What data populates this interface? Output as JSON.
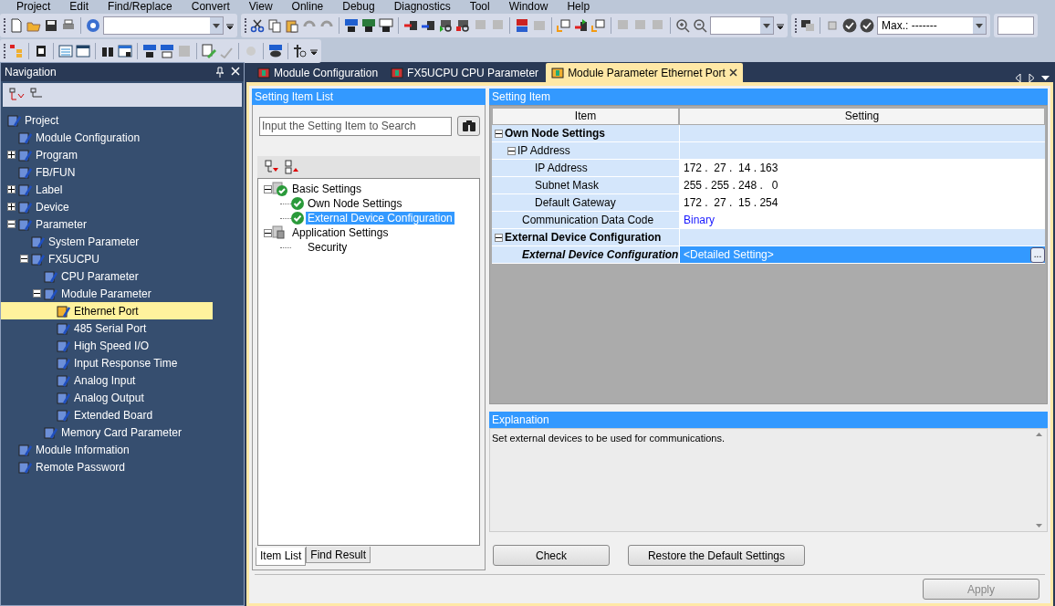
{
  "menu": [
    "Project",
    "Edit",
    "Find/Replace",
    "Convert",
    "View",
    "Online",
    "Debug",
    "Diagnostics",
    "Tool",
    "Window",
    "Help"
  ],
  "toolbar": {
    "monitor_combo": "Max.: -------"
  },
  "navigation": {
    "title": "Navigation",
    "tree": [
      {
        "label": "Project",
        "children": [
          {
            "label": "Module Configuration",
            "selected": false
          },
          {
            "label": "Program",
            "expanded": false,
            "selected": false
          },
          {
            "label": "FB/FUN",
            "selected": false
          },
          {
            "label": "Label",
            "expanded": false,
            "selected": false
          },
          {
            "label": "Device",
            "expanded": false,
            "selected": false
          },
          {
            "label": "Parameter",
            "expanded": true,
            "selected": false,
            "children": [
              {
                "label": "System Parameter",
                "selected": false
              },
              {
                "label": "FX5UCPU",
                "expanded": true,
                "selected": false,
                "children": [
                  {
                    "label": "CPU Parameter",
                    "selected": false
                  },
                  {
                    "label": "Module Parameter",
                    "expanded": true,
                    "selected": false,
                    "children": [
                      {
                        "label": "Ethernet Port",
                        "selected": true
                      },
                      {
                        "label": "485 Serial Port",
                        "selected": false
                      },
                      {
                        "label": "High Speed I/O",
                        "selected": false
                      },
                      {
                        "label": "Input Response Time",
                        "selected": false
                      },
                      {
                        "label": "Analog Input",
                        "selected": false
                      },
                      {
                        "label": "Analog Output",
                        "selected": false
                      },
                      {
                        "label": "Extended Board",
                        "selected": false
                      }
                    ]
                  },
                  {
                    "label": "Memory Card Parameter",
                    "selected": false
                  }
                ]
              }
            ]
          },
          {
            "label": "Module Information",
            "selected": false
          },
          {
            "label": "Remote Password",
            "selected": false
          }
        ],
        "selected": false
      }
    ]
  },
  "doc_tabs": [
    {
      "label": "Module Configuration",
      "selected": false,
      "closable": false
    },
    {
      "label": "FX5UCPU CPU Parameter",
      "selected": false,
      "closable": false
    },
    {
      "label": "Module Parameter Ethernet Port",
      "selected": true,
      "closable": true
    }
  ],
  "setting_item_list": {
    "title": "Setting Item List",
    "search": {
      "placeholder": "Input the Setting Item to Search"
    },
    "tree": [
      {
        "label": "Basic Settings",
        "expanded": true,
        "checked": true,
        "selected": false,
        "children": [
          {
            "label": "Own Node Settings",
            "checked": true,
            "selected": false
          },
          {
            "label": "External Device Configuration",
            "checked": true,
            "selected": true
          }
        ]
      },
      {
        "label": "Application Settings",
        "expanded": true,
        "checked": false,
        "selected": false,
        "children": [
          {
            "label": "Security",
            "checked": false,
            "selected": false
          }
        ]
      }
    ],
    "tabs": [
      {
        "label": "Item List",
        "selected": true
      },
      {
        "label": "Find Result",
        "selected": false
      }
    ]
  },
  "setting_item": {
    "title": "Setting Item",
    "columns": [
      "Item",
      "Setting"
    ],
    "rows": [
      {
        "item": "Own Node Settings",
        "kind": "group",
        "expanded": true,
        "selected": false,
        "children": [
          {
            "item": "IP Address",
            "kind": "subgroup",
            "expanded": true,
            "selected": false,
            "children": [
              {
                "item": "IP Address",
                "value": "172 .  27 .  14 . 163",
                "selected": false
              },
              {
                "item": "Subnet Mask",
                "value": "255 . 255 . 248 .   0",
                "selected": false
              },
              {
                "item": "Default Gateway",
                "value": "172 .  27 .  15 . 254",
                "selected": false
              }
            ]
          },
          {
            "item": "Communication Data Code",
            "kind": "select",
            "value": "Binary",
            "selected": false
          }
        ]
      },
      {
        "item": "External Device Configuration",
        "kind": "group",
        "expanded": true,
        "selected": false,
        "children": [
          {
            "item": "External Device Configuration",
            "kind": "detail",
            "value": "<Detailed Setting>",
            "button": "...",
            "selected": true
          }
        ]
      }
    ]
  },
  "explanation": {
    "title": "Explanation",
    "text": "Set external devices to be used for communications."
  },
  "buttons": [
    {
      "label": "Check"
    },
    {
      "label": "Restore the Default Settings"
    }
  ],
  "apply": {
    "label": "Apply",
    "disabled": true
  }
}
